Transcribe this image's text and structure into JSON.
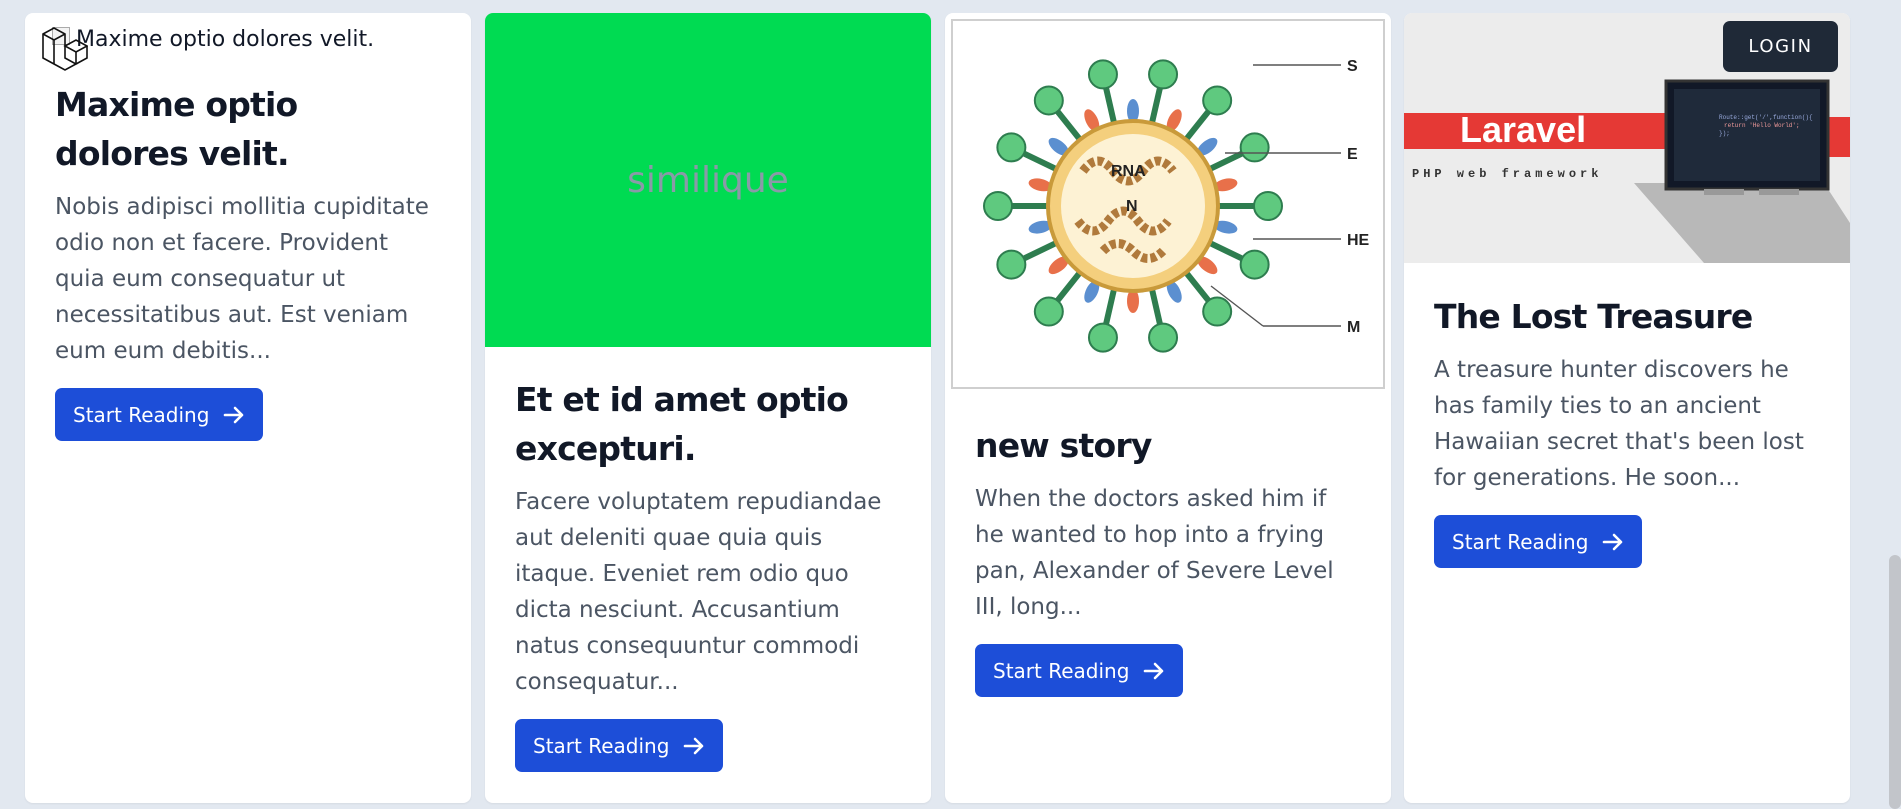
{
  "header": {
    "login_label": "LOGIN",
    "logo_icon": "laravel-logo-icon"
  },
  "cards": [
    {
      "image_alt": "Maxime optio dolores velit.",
      "title": "Maxime optio dolores velit.",
      "description": "Nobis adipisci mollitia cupiditate odio non et facere. Provident quia eum consequatur ut necessitatibus aut. Est veniam eum eum debitis...",
      "button_label": "Start Reading",
      "button_icon": "arrow-right-icon"
    },
    {
      "image_text": "similique",
      "image_color": "#00db52",
      "title": "Et et id amet optio excepturi.",
      "description": "Facere voluptatem repudiandae aut deleniti quae quia quis itaque. Eveniet rem odio quo dicta nesciunt. Accusantium natus consequuntur commodi consequatur...",
      "button_label": "Start Reading",
      "button_icon": "arrow-right-icon"
    },
    {
      "image_labels": [
        "S",
        "E",
        "HE",
        "M",
        "RNA",
        "N"
      ],
      "title": "new story",
      "description": "When the doctors asked him if he wanted to hop into a frying pan, Alexander of Severe Level III, long...",
      "button_label": "Start Reading",
      "button_icon": "arrow-right-icon"
    },
    {
      "image_brand": "Laravel",
      "image_tagline": "PHP web framework",
      "title": "The Lost Treasure",
      "description": "A treasure hunter discovers he has family ties to an ancient Hawaiian secret that's been lost for generations. He soon...",
      "button_label": "Start Reading",
      "button_icon": "arrow-right-icon"
    }
  ],
  "colors": {
    "background": "#e2e8f0",
    "button": "#1d4ed8",
    "login_button": "#1f2937"
  }
}
